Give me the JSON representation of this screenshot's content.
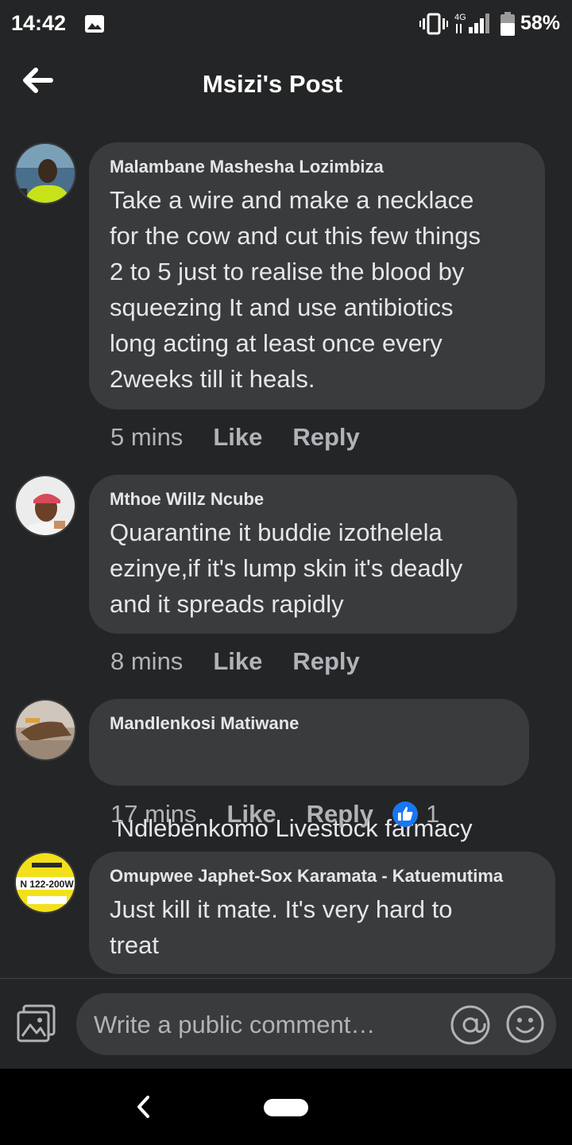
{
  "status_bar": {
    "time": "14:42",
    "network": "4G",
    "battery": "58%"
  },
  "header": {
    "title": "Msizi's Post"
  },
  "comments": [
    {
      "author": "Malambane Mashesha Lozimbiza",
      "lines": [
        "Take a wire and make a necklace",
        "for the cow and cut this few things",
        "2 to 5 just to realise the blood by",
        "squeezing It and use antibiotics",
        "long acting at least once every",
        "2weeks till it heals."
      ],
      "time": "5 mins",
      "like_label": "Like",
      "reply_label": "Reply"
    },
    {
      "author": "Mthoe Willz Ncube",
      "lines": [
        "Quarantine it buddie izothelela",
        "ezinye,if it's lump skin it's deadly",
        "and it spreads rapidly"
      ],
      "time": "8 mins",
      "like_label": "Like",
      "reply_label": "Reply"
    },
    {
      "author": "Mandlenkosi Matiwane",
      "lines": [
        " Ndlebenkomo Livestock farmacy"
      ],
      "time": "17 mins",
      "like_label": "Like",
      "reply_label": "Reply",
      "reaction_count": "1"
    },
    {
      "author": "Omupwee Japhet-Sox Karamata - Katuemutima",
      "avatar_text": "N 122-200W",
      "lines": [
        "Just kill it mate. It's very hard to",
        "treat"
      ]
    }
  ],
  "composer": {
    "placeholder": "Write a public comment…"
  },
  "colors": {
    "background": "#242526",
    "bubble": "#3a3b3c",
    "text": "#e4e6eb",
    "muted": "#b0b3b8",
    "like_blue": "#1877f2"
  },
  "icons": [
    "gallery-icon",
    "vibrate-icon",
    "signal-icon",
    "battery-icon",
    "back-arrow-icon",
    "like-reaction-icon",
    "photo-icon",
    "at-icon",
    "emoji-icon",
    "nav-back-icon",
    "home-pill-icon"
  ]
}
